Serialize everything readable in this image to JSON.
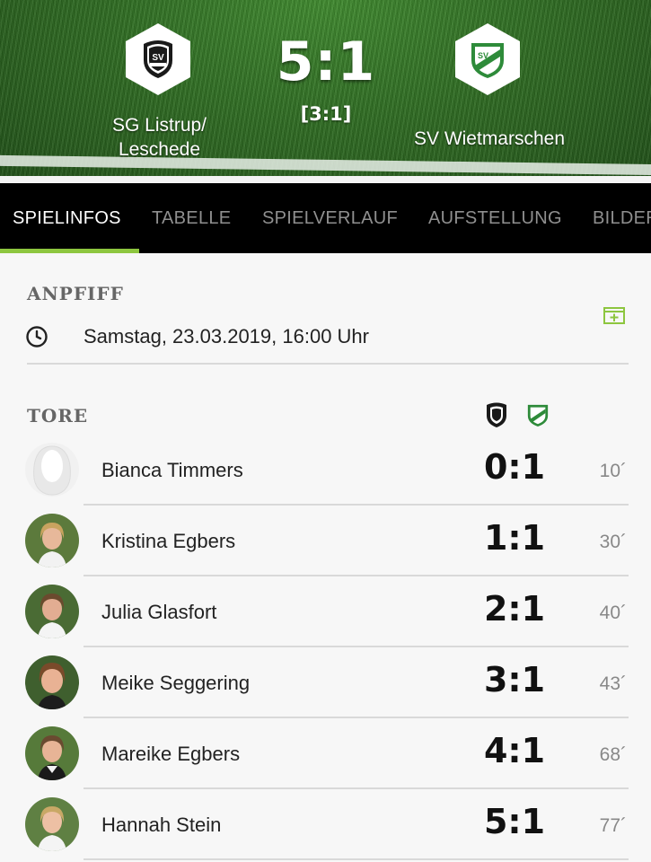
{
  "match": {
    "home_team": "SG Listrup/ Leschede",
    "away_team": "SV Wietmarschen",
    "score": "5:1",
    "halftime": "[3:1]",
    "home_crest_icon": "sv-listrup-crest-icon",
    "away_crest_icon": "sv-wietmarschen-crest-icon"
  },
  "tabs": [
    {
      "label": "SPIELINFOS",
      "active": true
    },
    {
      "label": "TABELLE",
      "active": false
    },
    {
      "label": "SPIELVERLAUF",
      "active": false
    },
    {
      "label": "AUFSTELLUNG",
      "active": false
    },
    {
      "label": "BILDER",
      "active": false
    }
  ],
  "kickoff": {
    "title": "ANPFIFF",
    "datetime": "Samstag, 23.03.2019, 16:00 Uhr",
    "clock_icon": "clock-icon",
    "add_calendar_icon": "calendar-add-icon"
  },
  "goals": {
    "title": "TORE",
    "items": [
      {
        "player": "Bianca Timmers",
        "score": "0:1",
        "minute": "10´"
      },
      {
        "player": "Kristina Egbers",
        "score": "1:1",
        "minute": "30´"
      },
      {
        "player": "Julia Glasfort",
        "score": "2:1",
        "minute": "40´"
      },
      {
        "player": "Meike Seggering",
        "score": "3:1",
        "minute": "43´"
      },
      {
        "player": "Mareike Egbers",
        "score": "4:1",
        "minute": "68´"
      },
      {
        "player": "Hannah Stein",
        "score": "5:1",
        "minute": "77´"
      }
    ]
  },
  "colors": {
    "accent": "#8dc63f",
    "tab_bar": "#000000",
    "pitch": "#2f6d22"
  }
}
